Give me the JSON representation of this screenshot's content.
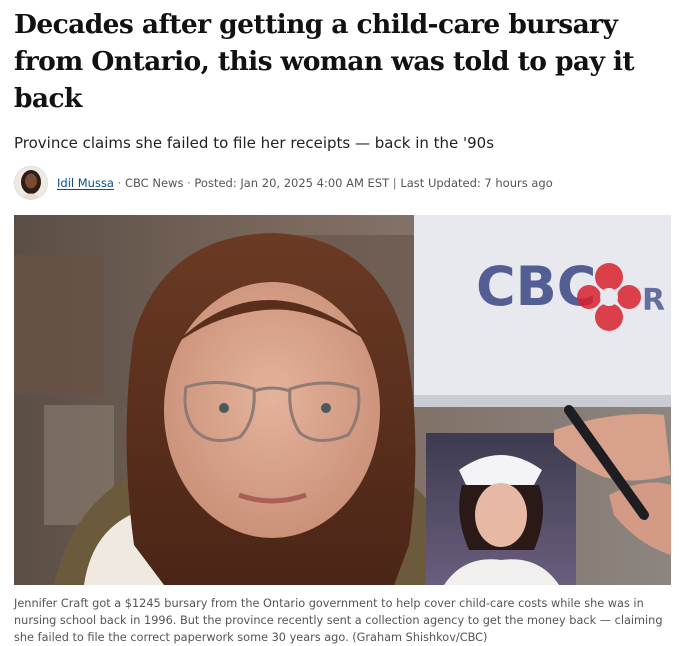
{
  "article": {
    "headline": "Decades after getting a child-care bursary from Ontario, this woman was told to pay it back",
    "dek": "Province claims she failed to file her receipts — back in the '90s",
    "byline": {
      "author": "Idil Mussa",
      "separator": "·",
      "outlet": "CBC News",
      "posted": "Posted: Jan 20, 2025 4:00 AM EST",
      "divider": "|",
      "updated": "Last Updated: 7 hours ago"
    },
    "photo": {
      "sign_text": "CBC",
      "caption": "Jennifer Craft got a $1245 bursary from the Ontario government to help cover child-care costs while she was in nursing school back in 1996. But the province recently sent a collection agency to get the money back — claiming she failed to file the correct paperwork some 30 years ago. (Graham Shishkov/CBC)"
    }
  },
  "colors": {
    "link": "#0a4d8c",
    "cbc_red": "#d9232e",
    "cbc_blue": "#2f3c7e"
  }
}
